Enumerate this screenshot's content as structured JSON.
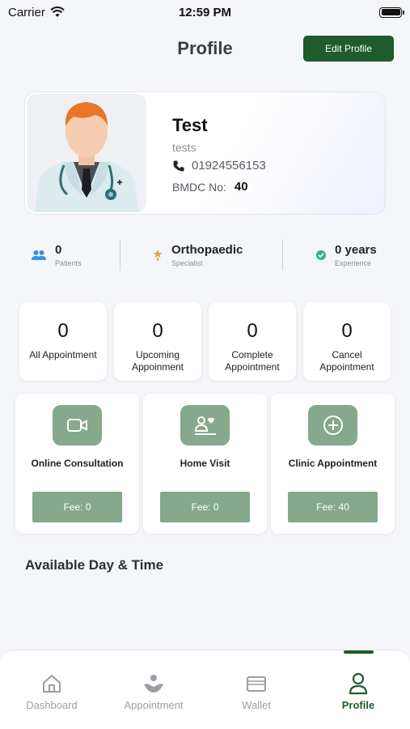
{
  "status_bar": {
    "carrier": "Carrier",
    "time": "12:59 PM"
  },
  "header": {
    "title": "Profile",
    "edit_button": "Edit Profile"
  },
  "profile": {
    "name": "Test",
    "subtitle": "tests",
    "phone": "01924556153",
    "bmdc_label": "BMDC No:",
    "bmdc_value": "40"
  },
  "stats": [
    {
      "value": "0",
      "label": "Patients",
      "icon": "patients-icon"
    },
    {
      "value": "Orthopaedic",
      "label": "Specialist",
      "icon": "specialist-icon"
    },
    {
      "value": "0 years",
      "label": "Experience",
      "icon": "verified-icon"
    }
  ],
  "counts": [
    {
      "value": "0",
      "label": "All Appointment"
    },
    {
      "value": "0",
      "label": "Upcoming Appoinment"
    },
    {
      "value": "0",
      "label": "Complete Appointment"
    },
    {
      "value": "0",
      "label": "Cancel Appointment"
    }
  ],
  "services": [
    {
      "title": "Online Consultation",
      "fee": "Fee: 0",
      "icon": "video-icon"
    },
    {
      "title": "Home Visit",
      "fee": "Fee: 0",
      "icon": "home-visit-icon"
    },
    {
      "title": "Clinic Appointment",
      "fee": "Fee: 40",
      "icon": "plus-circle-icon"
    }
  ],
  "available_section_title": "Available Day & Time",
  "nav": [
    {
      "label": "Dashboard",
      "icon": "home-icon"
    },
    {
      "label": "Appointment",
      "icon": "appointment-icon"
    },
    {
      "label": "Wallet",
      "icon": "wallet-icon"
    },
    {
      "label": "Profile",
      "icon": "profile-icon",
      "active": true
    }
  ],
  "colors": {
    "primary": "#1f5b2c",
    "service_accent": "#86a88c",
    "patients_icon": "#3b8fe0",
    "specialist_icon": "#e8a23a",
    "verified_icon": "#2cb67d"
  }
}
